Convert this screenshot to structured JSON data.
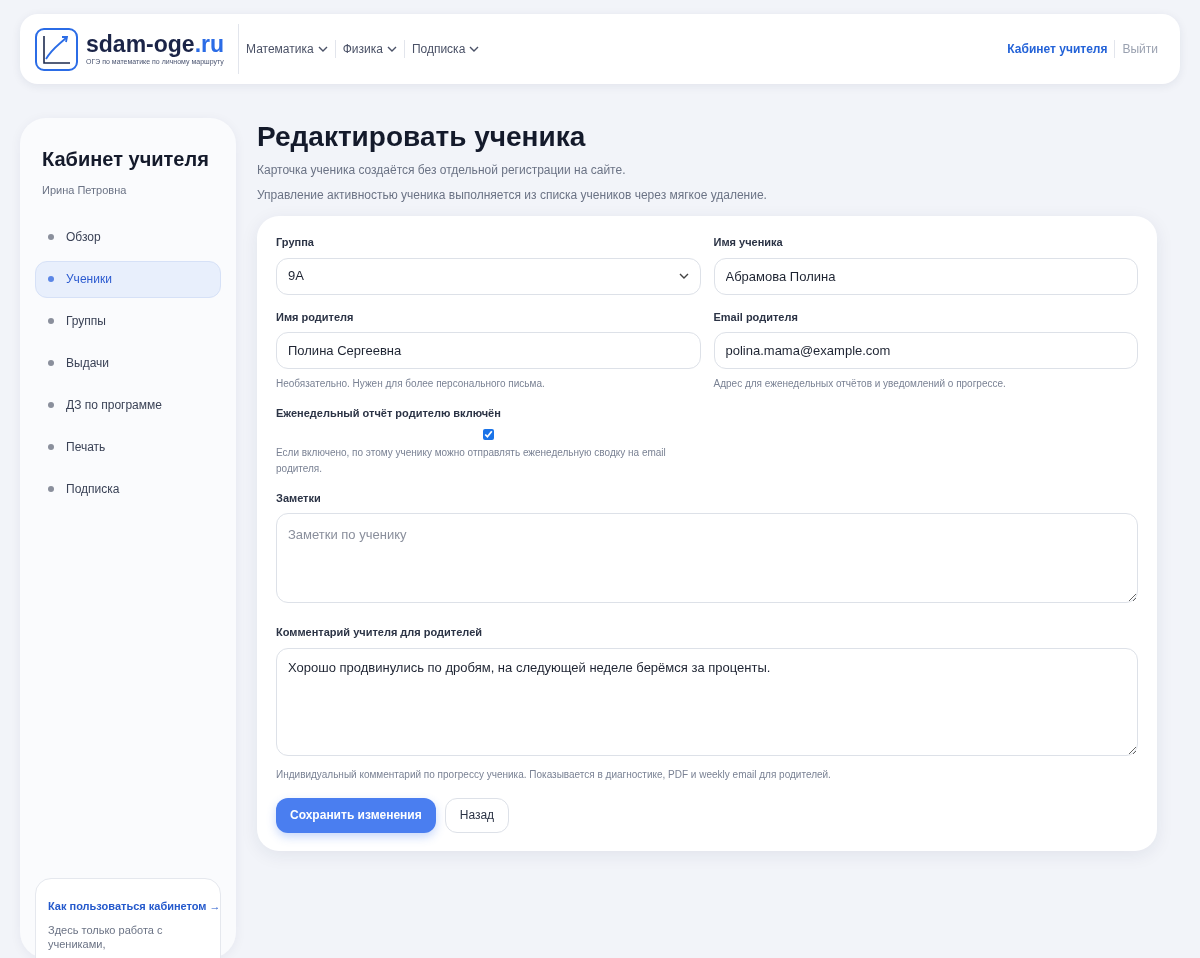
{
  "header": {
    "logo": {
      "name": "sdam-oge",
      "tld": ".ru",
      "tagline": "ОГЭ по математике по личному маршруту"
    },
    "nav": [
      {
        "label": "Математика"
      },
      {
        "label": "Физика"
      },
      {
        "label": "Подписка"
      }
    ],
    "account": [
      {
        "label": "Кабинет учителя",
        "selected": true
      },
      {
        "label": "Выйти",
        "selected": false
      }
    ]
  },
  "sidebar": {
    "title": "Кабинет учителя",
    "subtitle": "Ирина Петровна",
    "items": [
      {
        "label": "Обзор",
        "selected": false
      },
      {
        "label": "Ученики",
        "selected": true
      },
      {
        "label": "Группы",
        "selected": false
      },
      {
        "label": "Выдачи",
        "selected": false
      },
      {
        "label": "ДЗ по программе",
        "selected": false
      },
      {
        "label": "Печать",
        "selected": false
      },
      {
        "label": "Подписка",
        "selected": false
      }
    ],
    "help": {
      "link": "Как пользоваться кабинетом →",
      "text": "Здесь только работа с учениками,"
    }
  },
  "page": {
    "title": "Редактировать ученика",
    "notes": [
      "Карточка ученика создаётся без отдельной регистрации на сайте.",
      "Управление активностью ученика выполняется из списка учеников через мягкое удаление."
    ]
  },
  "form": {
    "group": {
      "label": "Группа",
      "value": "9А"
    },
    "student_name": {
      "label": "Имя ученика",
      "value": "Абрамова Полина"
    },
    "parent_name": {
      "label": "Имя родителя",
      "value": "Полина Сергеевна",
      "hint": "Необязательно. Нужен для более персонального письма."
    },
    "parent_email": {
      "label": "Email родителя",
      "value": "polina.mama@example.com",
      "hint": "Адрес для еженедельных отчётов и уведомлений о прогрессе."
    },
    "weekly_report": {
      "label": "Еженедельный отчёт родителю включён",
      "checked": true,
      "hint": "Если включено, по этому ученику можно отправлять еженедельную сводку на email родителя."
    },
    "notes": {
      "label": "Заметки",
      "placeholder": "Заметки по ученику"
    },
    "comment": {
      "label": "Комментарий учителя для родителей",
      "value": "Хорошо продвинулись по дробям, на следующей неделе берёмся за проценты.",
      "hint": "Индивидуальный комментарий по прогрессу ученика. Показывается в диагностике, PDF и weekly email для родителей."
    },
    "buttons": [
      {
        "label": "Сохранить изменения",
        "kind": "primary"
      },
      {
        "label": "Назад",
        "kind": "secondary"
      }
    ]
  }
}
